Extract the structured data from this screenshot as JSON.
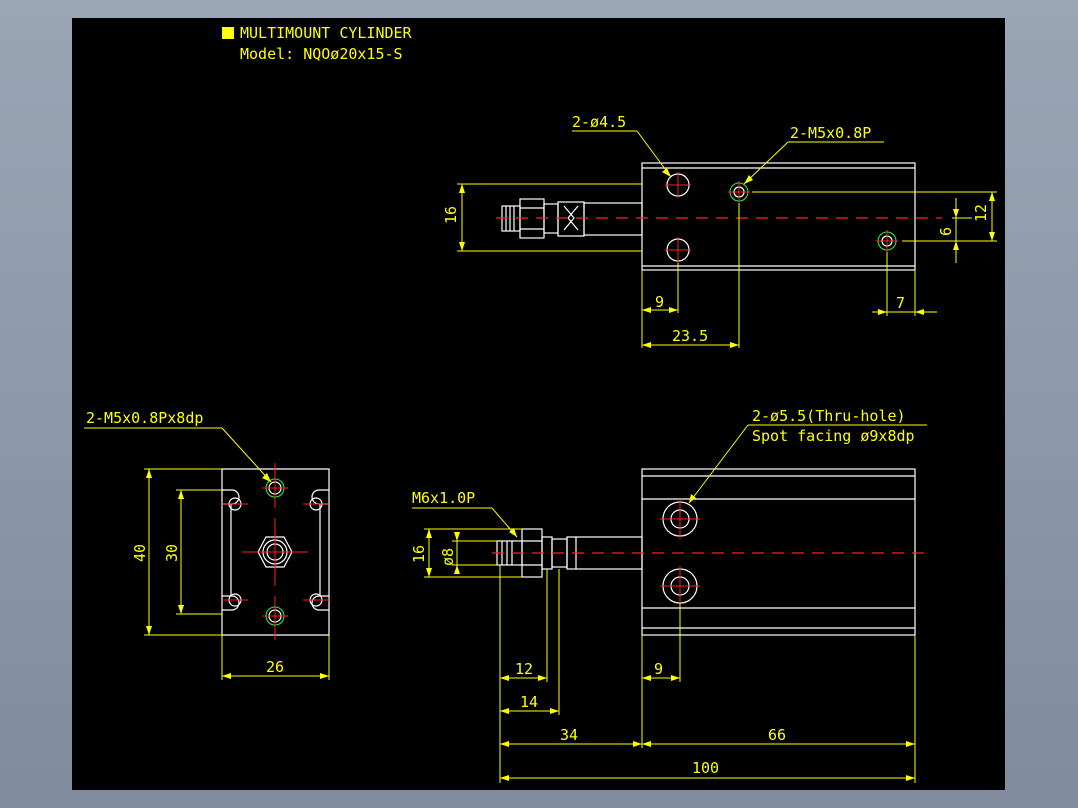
{
  "header": {
    "title": "MULTIMOUNT CYLINDER",
    "model": "Model: NQOø20x15-S",
    "title_marker_color": "#ffff00"
  },
  "top_view": {
    "hole_label": "2-ø4.5",
    "thread_label": "2-M5x0.8P",
    "dim_16": "16",
    "dim_12": "12",
    "dim_6": "6",
    "dim_9": "9",
    "dim_7": "7",
    "dim_23_5": "23.5"
  },
  "end_view": {
    "thread_label": "2-M5x0.8Px8dp",
    "dim_40": "40",
    "dim_30": "30",
    "dim_26": "26"
  },
  "side_view": {
    "thru_label": "2-ø5.5(Thru-hole)",
    "spot_label": "Spot facing ø9x8dp",
    "rod_thread": "M6x1.0P",
    "dim_16": "16",
    "dim_phi8": "ø8",
    "dim_12": "12",
    "dim_14": "14",
    "dim_9": "9",
    "dim_34": "34",
    "dim_66": "66",
    "dim_100": "100"
  },
  "colors": {
    "background": "#000000",
    "outline": "#ffffff",
    "dimension": "#ffff00",
    "centerline": "#ff2020",
    "thread": "#20ff40"
  }
}
